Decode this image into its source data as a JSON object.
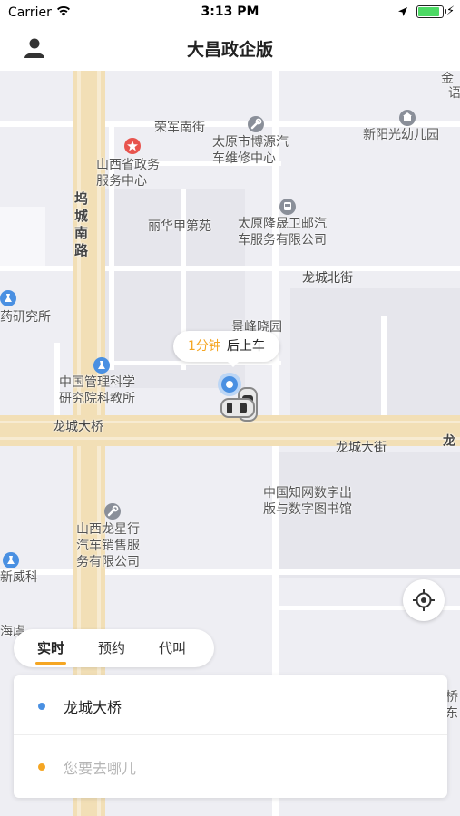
{
  "status_bar": {
    "carrier": "Carrier",
    "time": "3:13 PM",
    "battery_level": 0.9
  },
  "nav": {
    "title": "大昌政企版",
    "profile_icon": "person-icon"
  },
  "map": {
    "labels": {
      "rongjun": "荣军南街",
      "boyuan": "太原市博源汽\n车维修中心",
      "xinyang": "新阳光幼儿园",
      "gov_service": "山西省政务\n服务中心",
      "wucheng": "坞城南路",
      "lihua": "丽华甲第苑",
      "longsheng": "太原隆晟卫邮汽\n车服务有限公司",
      "longcheng_north": "龙城北街",
      "pharma": "药研究所",
      "jingfeng": "景峰晓园",
      "cmsa": "中国管理科学\n研究院科教所",
      "longcheng_bridge_road": "龙城大桥",
      "longcheng_avenue": "龙城大街",
      "long_edge": "龙",
      "cnki": "中国知网数字出\n版与数字图书馆",
      "longxingxing": "山西龙星行\n汽车销售服\n务有限公司",
      "xinweike": "新威科",
      "jin": "金",
      "yu": "语",
      "hai": "海虞",
      "qiao": "桥",
      "dong": "东"
    },
    "bubble": {
      "eta": "1分钟",
      "suffix": "后上车"
    },
    "colors": {
      "main_road": "#f4e3bd",
      "side_road": "#ffffff",
      "pin": "#4a90e2",
      "accent": "#f5a623"
    }
  },
  "mode_tabs": [
    {
      "label": "实时",
      "active": true
    },
    {
      "label": "预约",
      "active": false
    },
    {
      "label": "代叫",
      "active": false
    }
  ],
  "address": {
    "from": "龙城大桥",
    "to_placeholder": "您要去哪儿",
    "from_dot_color": "#4a90e2",
    "to_dot_color": "#f5a623"
  }
}
